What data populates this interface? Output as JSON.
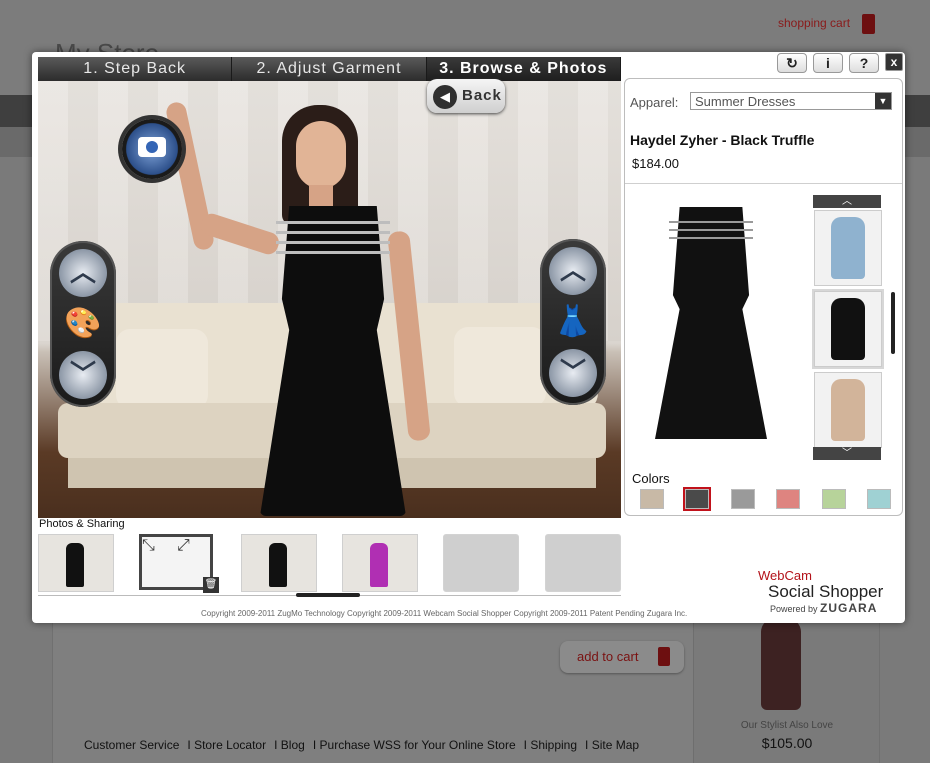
{
  "store": {
    "title": "My Store",
    "cart_link": "shopping cart",
    "add_to_cart": "add to cart",
    "stylist_label": "Our Stylist Also Love",
    "stylist_price": "$105.00",
    "footer_links": [
      "Customer Service",
      "Store Locator",
      "Blog",
      "Purchase WSS for Your Online Store",
      "Shipping",
      "Site Map"
    ]
  },
  "modal": {
    "tabs": [
      {
        "label": "1. Step Back"
      },
      {
        "label": "2. Adjust Garment"
      },
      {
        "label": "3. Browse & Photos"
      }
    ],
    "active_tab": 2,
    "back_label": "Back",
    "top_icons": [
      "↻",
      "i",
      "?",
      "x"
    ],
    "apparel": {
      "label": "Apparel:",
      "selected": "Summer Dresses"
    },
    "product": {
      "name": "Haydel Zyher - Black Truffle",
      "price": "$184.00"
    },
    "colors_label": "Colors",
    "colors": [
      "#c8b9a6",
      "#4a4a4a",
      "#9a9a9a",
      "#de8480",
      "#b7d39a",
      "#9fd1d3"
    ],
    "selected_color_index": 1,
    "thumbnails": [
      {
        "name": "light-blue-floral-dress",
        "color": "#8fb2cf"
      },
      {
        "name": "black-ruffle-dress",
        "color": "#111111"
      },
      {
        "name": "floral-skirt-dress",
        "color": "#d2b49a"
      }
    ],
    "photos_label": "Photos & Sharing",
    "photos": [
      {
        "type": "photo",
        "dress": "#111111"
      },
      {
        "type": "fullscreen",
        "dress": "#aaaaaa"
      },
      {
        "type": "photo",
        "dress": "#111111"
      },
      {
        "type": "photo",
        "dress": "#b02fb3"
      },
      {
        "type": "empty"
      },
      {
        "type": "empty"
      }
    ],
    "copyright": "Copyright 2009-2011 ZugMo Technology Copyright 2009-2011 Webcam Social Shopper Copyright 2009-2011 Patent Pending Zugara Inc.",
    "brand": {
      "webcam": "WebCam",
      "social_shopper": "Social Shopper",
      "powered_by": "Powered by",
      "company": "ZUGARA"
    }
  }
}
